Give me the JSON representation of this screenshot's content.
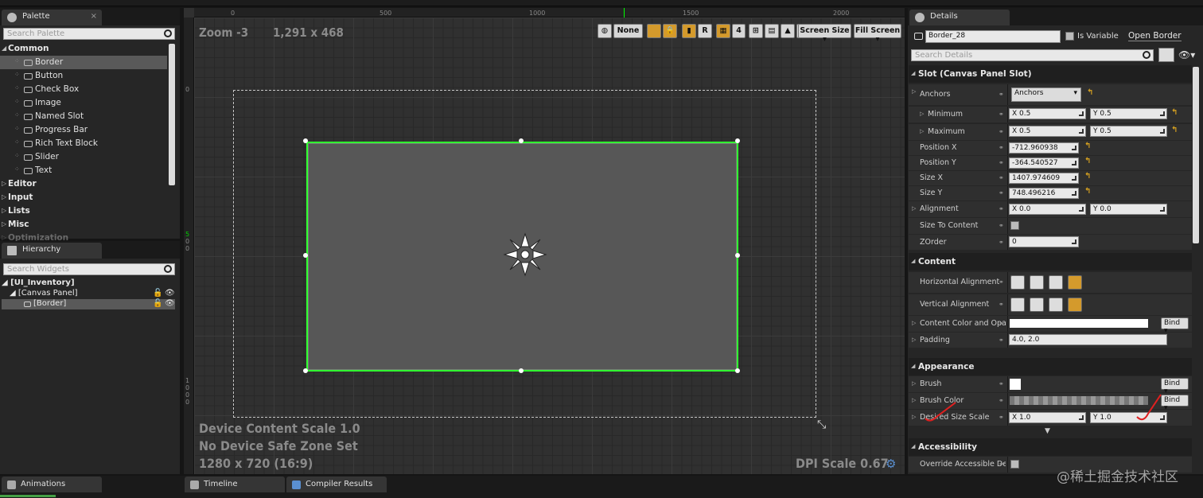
{
  "palette": {
    "title": "Palette",
    "search_placeholder": "Search Palette",
    "common_label": "Common",
    "items": [
      "Border",
      "Button",
      "Check Box",
      "Image",
      "Named Slot",
      "Progress Bar",
      "Rich Text Block",
      "Slider",
      "Text"
    ],
    "categories": [
      "Editor",
      "Input",
      "Lists",
      "Misc",
      "Optimization"
    ]
  },
  "hierarchy": {
    "title": "Hierarchy",
    "search_placeholder": "Search Widgets",
    "root": "[UI_Inventory]",
    "canvas": "[Canvas Panel]",
    "border": "[Border]"
  },
  "viewport": {
    "zoom": "Zoom -3",
    "size": "1,291 x 468",
    "ruler_h": [
      "0",
      "500",
      "1000",
      "1500",
      "2000"
    ],
    "ruler_v_top": "0",
    "ruler_v_mid": [
      "5",
      "0",
      "0"
    ],
    "ruler_v_bottom": [
      "1",
      "0",
      "0",
      "0"
    ],
    "none_label": "None",
    "r_label": "R",
    "grid_num": "4",
    "screen_size": "Screen Size",
    "fill_screen": "Fill Screen",
    "device_scale": "Device Content Scale 1.0",
    "safe_zone": "No Device Safe Zone Set",
    "resolution": "1280 x 720 (16:9)",
    "dpi": "DPI Scale 0.67"
  },
  "details": {
    "title": "Details",
    "name_value": "Border_28",
    "is_variable": "Is Variable",
    "open_border": "Open Border",
    "search_placeholder": "Search Details",
    "slot_section": "Slot (Canvas Panel Slot)",
    "anchors_label": "Anchors",
    "anchors_value": "Anchors",
    "minimum_label": "Minimum",
    "min_x": "X  0.5",
    "min_y": "Y  0.5",
    "maximum_label": "Maximum",
    "max_x": "X  0.5",
    "max_y": "Y  0.5",
    "posx_label": "Position X",
    "posx": "-712.960938",
    "posy_label": "Position Y",
    "posy": "-364.540527",
    "sizex_label": "Size X",
    "sizex": "1407.974609",
    "sizey_label": "Size Y",
    "sizey": "748.496216",
    "alignment_label": "Alignment",
    "align_x": "X  0.0",
    "align_y": "Y  0.0",
    "size_to_content_label": "Size To Content",
    "zorder_label": "ZOrder",
    "zorder": "0",
    "content_section": "Content",
    "halign_label": "Horizontal Alignment",
    "valign_label": "Vertical Alignment",
    "content_color_label": "Content Color and Opa",
    "bind": "Bind",
    "padding_label": "Padding",
    "padding": "4.0, 2.0",
    "appearance_section": "Appearance",
    "brush_label": "Brush",
    "brush_color_label": "Brush Color",
    "desired_label": "Desired Size Scale",
    "desired_x": "X  1.0",
    "desired_y": "Y  1.0",
    "accessibility_section": "Accessibility",
    "override_label": "Override Accessible Defa"
  },
  "bottom": {
    "animations": "Animations",
    "timeline": "Timeline",
    "compiler": "Compiler Results"
  },
  "watermark": "@稀土掘金技术社区"
}
